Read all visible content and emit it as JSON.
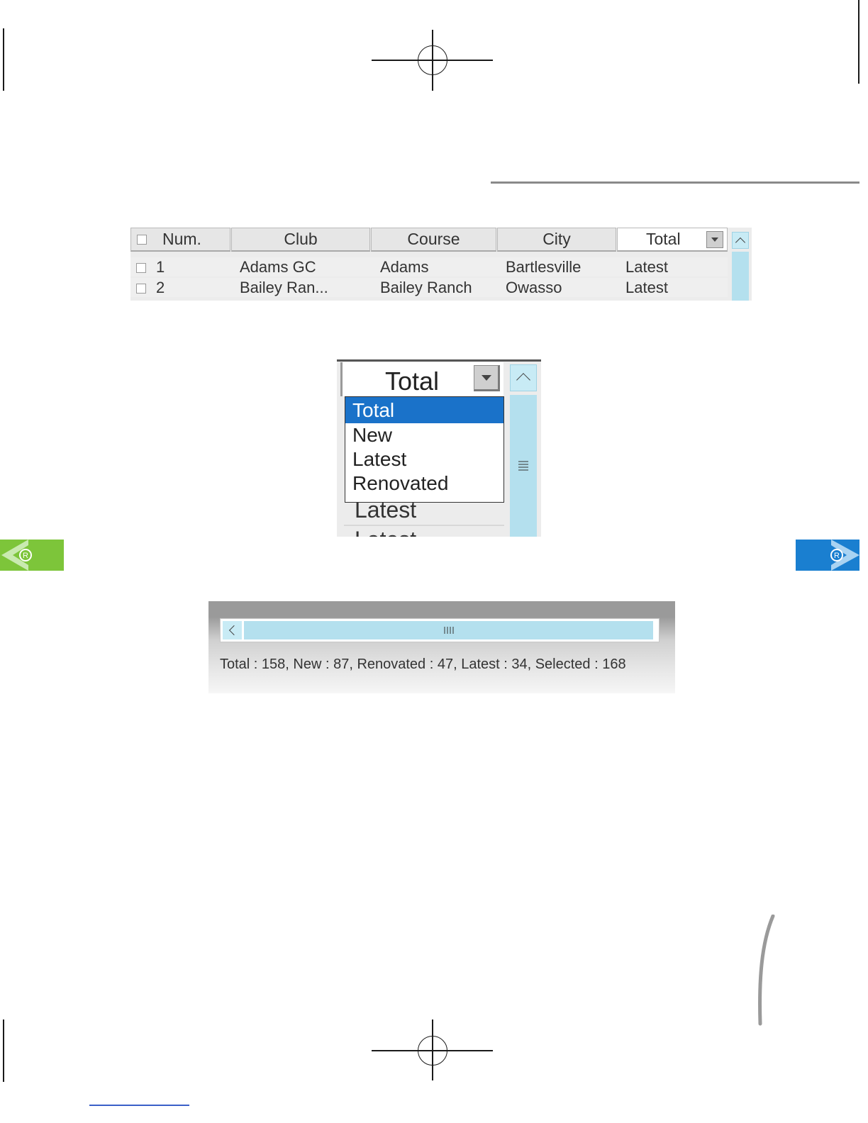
{
  "grid": {
    "headers": [
      "Num.",
      "Club",
      "Course",
      "City",
      "Total"
    ],
    "rows": [
      {
        "num": "1",
        "club": "Adams GC",
        "course": "Adams",
        "city": "Bartlesville",
        "total": "Latest"
      },
      {
        "num": "2",
        "club": "Bailey Ran...",
        "course": "Bailey Ranch",
        "city": "Owasso",
        "total": "Latest"
      }
    ]
  },
  "dropdown": {
    "selected": "Total",
    "options": [
      "Total",
      "New",
      "Latest",
      "Renovated"
    ],
    "below_row": "Latest",
    "below_row_partial": "Latest"
  },
  "statusbar": {
    "text": "Total : 158, New : 87, Renovated : 47, Latest : 34, Selected : 168"
  },
  "colors": {
    "selection": "#1a72c9",
    "scroll": "#b4e0ee",
    "nav_prev": "#7dc53a",
    "nav_next": "#1a7fd0"
  }
}
